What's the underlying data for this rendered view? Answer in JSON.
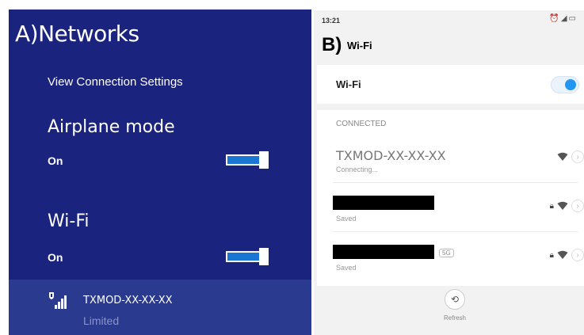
{
  "panel_a": {
    "letter": "A)",
    "title": "Networks",
    "view_settings_label": "View Connection Settings",
    "airplane_mode": {
      "title": "Airplane mode",
      "state": "On"
    },
    "wifi": {
      "title": "Wi-Fi",
      "state": "On"
    },
    "network": {
      "name": "TXMOD-XX-XX-XX",
      "status": "Limited"
    }
  },
  "panel_b": {
    "status_time": "13:21",
    "letter": "B)",
    "title": "Wi-Fi",
    "wifi_toggle_label": "Wi-Fi",
    "section_header": "CONNECTED",
    "networks": [
      {
        "name": "TXMOD-XX-XX-XX",
        "status": "Connecting..."
      },
      {
        "name": "",
        "status": "Saved"
      },
      {
        "name": "",
        "status": "Saved",
        "badge": "5G"
      }
    ],
    "refresh_label": "Refresh"
  },
  "colors": {
    "windows_bg": "#1a237e",
    "windows_selected": "#2a3a8e",
    "windows_accent": "#1976d2",
    "android_accent": "#2196f3"
  }
}
